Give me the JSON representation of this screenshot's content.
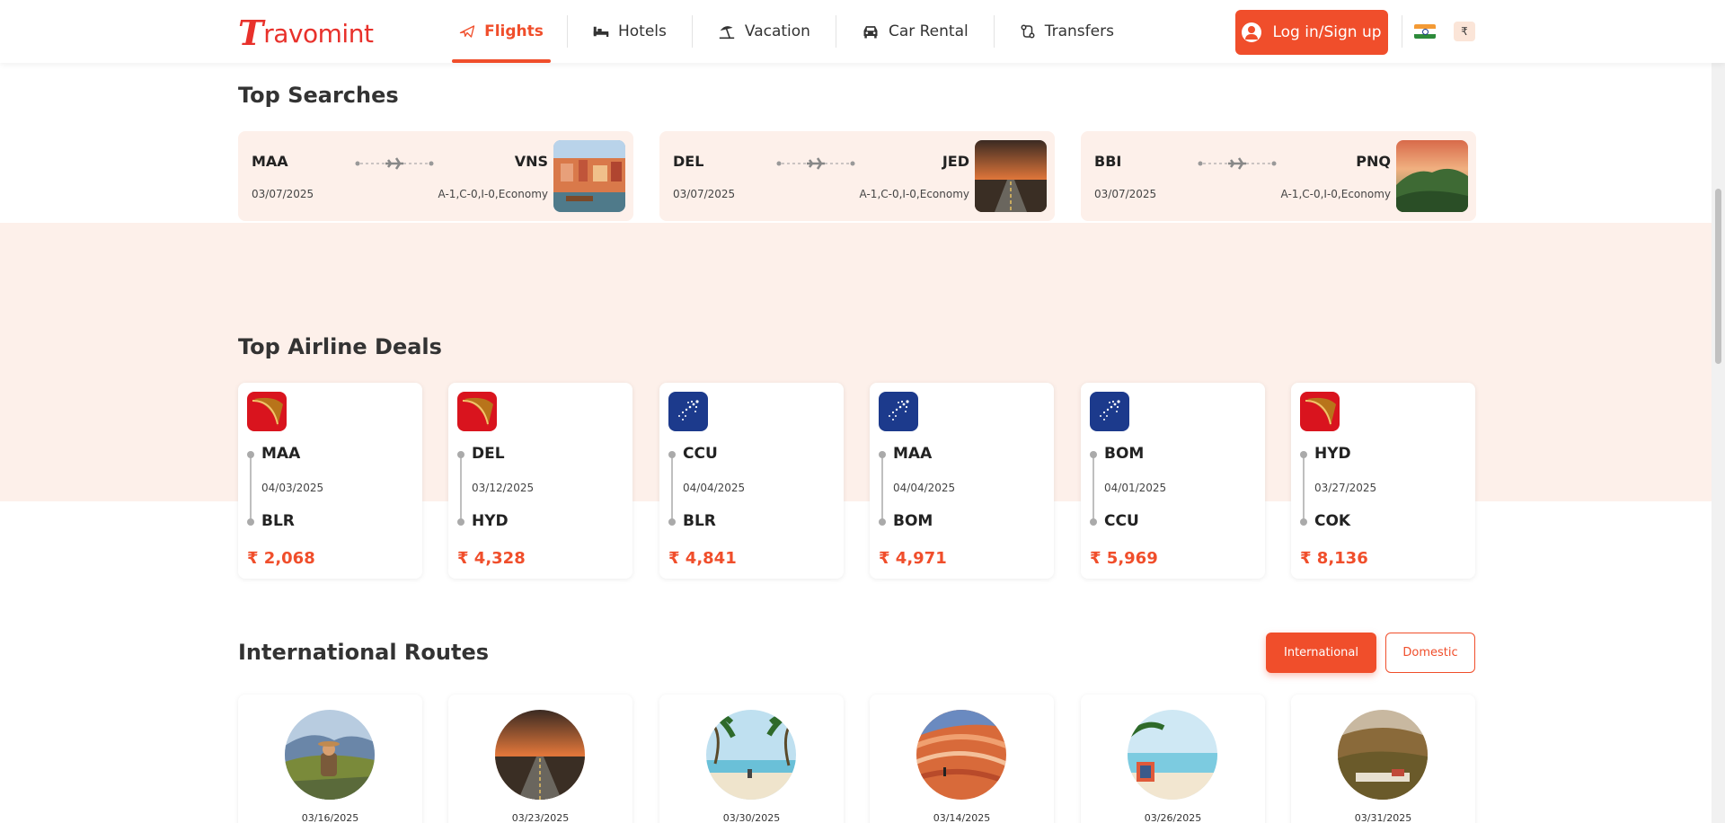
{
  "header": {
    "logo_first": "T",
    "logo_rest": "ravomint",
    "nav": [
      {
        "label": "Flights",
        "icon": "plane-icon"
      },
      {
        "label": "Hotels",
        "icon": "bed-icon"
      },
      {
        "label": "Vacation",
        "icon": "beach-umbrella-icon"
      },
      {
        "label": "Car Rental",
        "icon": "car-icon"
      },
      {
        "label": "Transfers",
        "icon": "transfer-icon"
      }
    ],
    "login_label": "Log in/Sign up",
    "currency_symbol": "₹",
    "flag": "india-flag-icon",
    "accent_color": "#f04e2b"
  },
  "top_searches": {
    "title": "Top Searches",
    "items": [
      {
        "from": "MAA",
        "to": "VNS",
        "date": "03/07/2025",
        "pax": "A-1,C-0,I-0,Economy",
        "image": "varanasi-city"
      },
      {
        "from": "DEL",
        "to": "JED",
        "date": "03/07/2025",
        "pax": "A-1,C-0,I-0,Economy",
        "image": "desert-road-sunset"
      },
      {
        "from": "BBI",
        "to": "PNQ",
        "date": "03/07/2025",
        "pax": "A-1,C-0,I-0,Economy",
        "image": "green-hills"
      }
    ]
  },
  "airline_deals": {
    "title": "Top Airline Deals",
    "items": [
      {
        "airline": "air-india-logo",
        "from": "MAA",
        "date": "04/03/2025",
        "to": "BLR",
        "price": "₹ 2,068"
      },
      {
        "airline": "air-india-logo",
        "from": "DEL",
        "date": "03/12/2025",
        "to": "HYD",
        "price": "₹ 4,328"
      },
      {
        "airline": "indigo-logo",
        "from": "CCU",
        "date": "04/04/2025",
        "to": "BLR",
        "price": "₹ 4,841"
      },
      {
        "airline": "indigo-logo",
        "from": "MAA",
        "date": "04/04/2025",
        "to": "BOM",
        "price": "₹ 4,971"
      },
      {
        "airline": "indigo-logo",
        "from": "BOM",
        "date": "04/01/2025",
        "to": "CCU",
        "price": "₹ 5,969"
      },
      {
        "airline": "air-india-logo",
        "from": "HYD",
        "date": "03/27/2025",
        "to": "COK",
        "price": "₹ 8,136"
      }
    ]
  },
  "routes": {
    "title": "International Routes",
    "toggle_international": "International",
    "toggle_domestic": "Domestic",
    "items": [
      {
        "date": "03/16/2025",
        "image": "hiker-mountains"
      },
      {
        "date": "03/23/2025",
        "image": "desert-road-sunset"
      },
      {
        "date": "03/30/2025",
        "image": "palm-beach"
      },
      {
        "date": "03/14/2025",
        "image": "red-canyon"
      },
      {
        "date": "03/26/2025",
        "image": "beach-chairs"
      },
      {
        "date": "03/31/2025",
        "image": "hills-picnic"
      }
    ]
  }
}
